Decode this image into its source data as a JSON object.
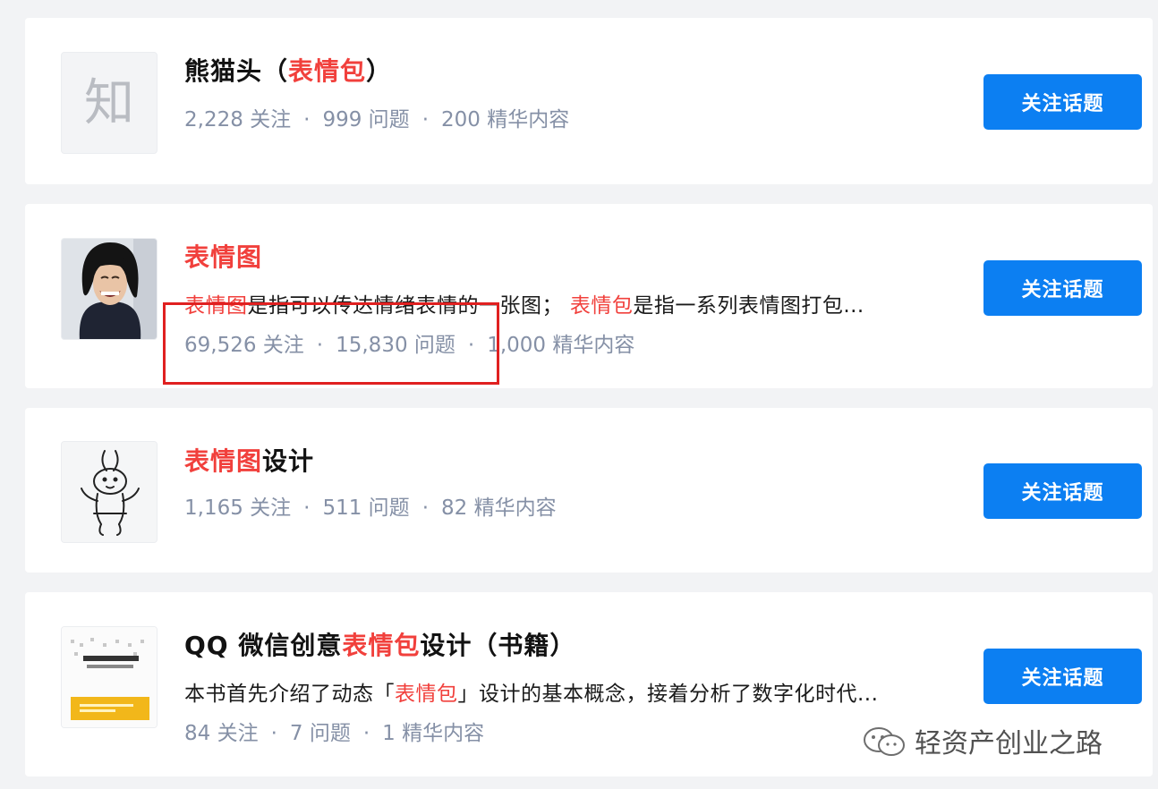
{
  "topics": [
    {
      "title_parts": [
        {
          "text": "熊猫头（",
          "hl": false
        },
        {
          "text": "表情包",
          "hl": true
        },
        {
          "text": "）",
          "hl": false
        }
      ],
      "avatar_icon": "zhihu-placeholder-icon",
      "avatar_char": "知",
      "excerpt_parts": [],
      "followers": "2,228 关注",
      "questions": "999 问题",
      "featured": "200 精华内容",
      "button_label": "关注话题"
    },
    {
      "title_parts": [
        {
          "text": "表情图",
          "hl": true
        }
      ],
      "avatar_icon": "laughing-person-photo",
      "excerpt_parts": [
        {
          "text": "表情图",
          "hl": true
        },
        {
          "text": "是指可以传达情绪表情的一张图； ",
          "hl": false
        },
        {
          "text": "表情包",
          "hl": true
        },
        {
          "text": "是指一系列表情图打包...",
          "hl": false
        }
      ],
      "followers": "69,526 关注",
      "questions": "15,830 问题",
      "featured": "1,000 精华内容",
      "button_label": "关注话题"
    },
    {
      "title_parts": [
        {
          "text": "表情图",
          "hl": true
        },
        {
          "text": "设计",
          "hl": false
        }
      ],
      "avatar_icon": "rabbit-sketch-icon",
      "excerpt_parts": [],
      "followers": "1,165 关注",
      "questions": "511 问题",
      "featured": "82 精华内容",
      "button_label": "关注话题"
    },
    {
      "title_parts": [
        {
          "text": "QQ 微信创意",
          "hl": false
        },
        {
          "text": "表情包",
          "hl": true
        },
        {
          "text": "设计（书籍）",
          "hl": false
        }
      ],
      "avatar_icon": "book-cover-icon",
      "excerpt_parts": [
        {
          "text": "本书首先介绍了动态「",
          "hl": false
        },
        {
          "text": "表情包",
          "hl": true
        },
        {
          "text": "」设计的基本概念，接着分析了数字化时代...",
          "hl": false
        }
      ],
      "followers": "84 关注",
      "questions": "7 问题",
      "featured": "1 精华内容",
      "button_label": "关注话题"
    }
  ],
  "separator": "·",
  "watermark": "轻资产创业之路",
  "colors": {
    "highlight": "#f1403c",
    "button": "#0c7ff2",
    "meta": "#8590a6",
    "annotation": "#e02020"
  }
}
